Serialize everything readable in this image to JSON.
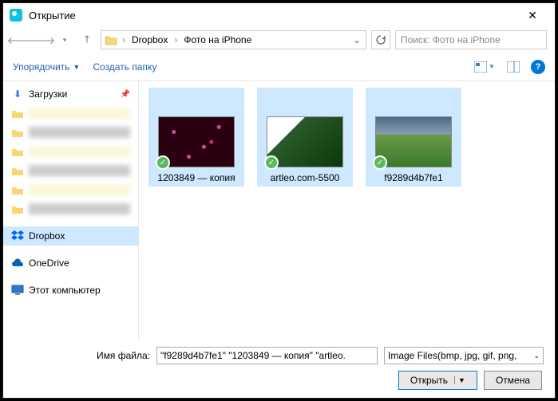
{
  "title": "Открытие",
  "breadcrumb": {
    "root": "Dropbox",
    "leaf": "Фото на iPhone"
  },
  "search_placeholder": "Поиск: Фото на iPhone",
  "toolbar": {
    "organize": "Упорядочить",
    "new_folder": "Создать папку"
  },
  "sidebar": {
    "downloads": "Загрузки",
    "dropbox": "Dropbox",
    "onedrive": "OneDrive",
    "this_pc": "Этот компьютер"
  },
  "thumbs": [
    {
      "name": "1203849 — копия"
    },
    {
      "name": "artleo.com-5500"
    },
    {
      "name": "f9289d4b7fe1"
    }
  ],
  "filename_label": "Имя файла:",
  "filename_value": "\"f9289d4b7fe1\" \"1203849 — копия\" \"artleo.",
  "filter": "Image Files(bmp, jpg, gif, png,",
  "buttons": {
    "open": "Открыть",
    "cancel": "Отмена"
  }
}
